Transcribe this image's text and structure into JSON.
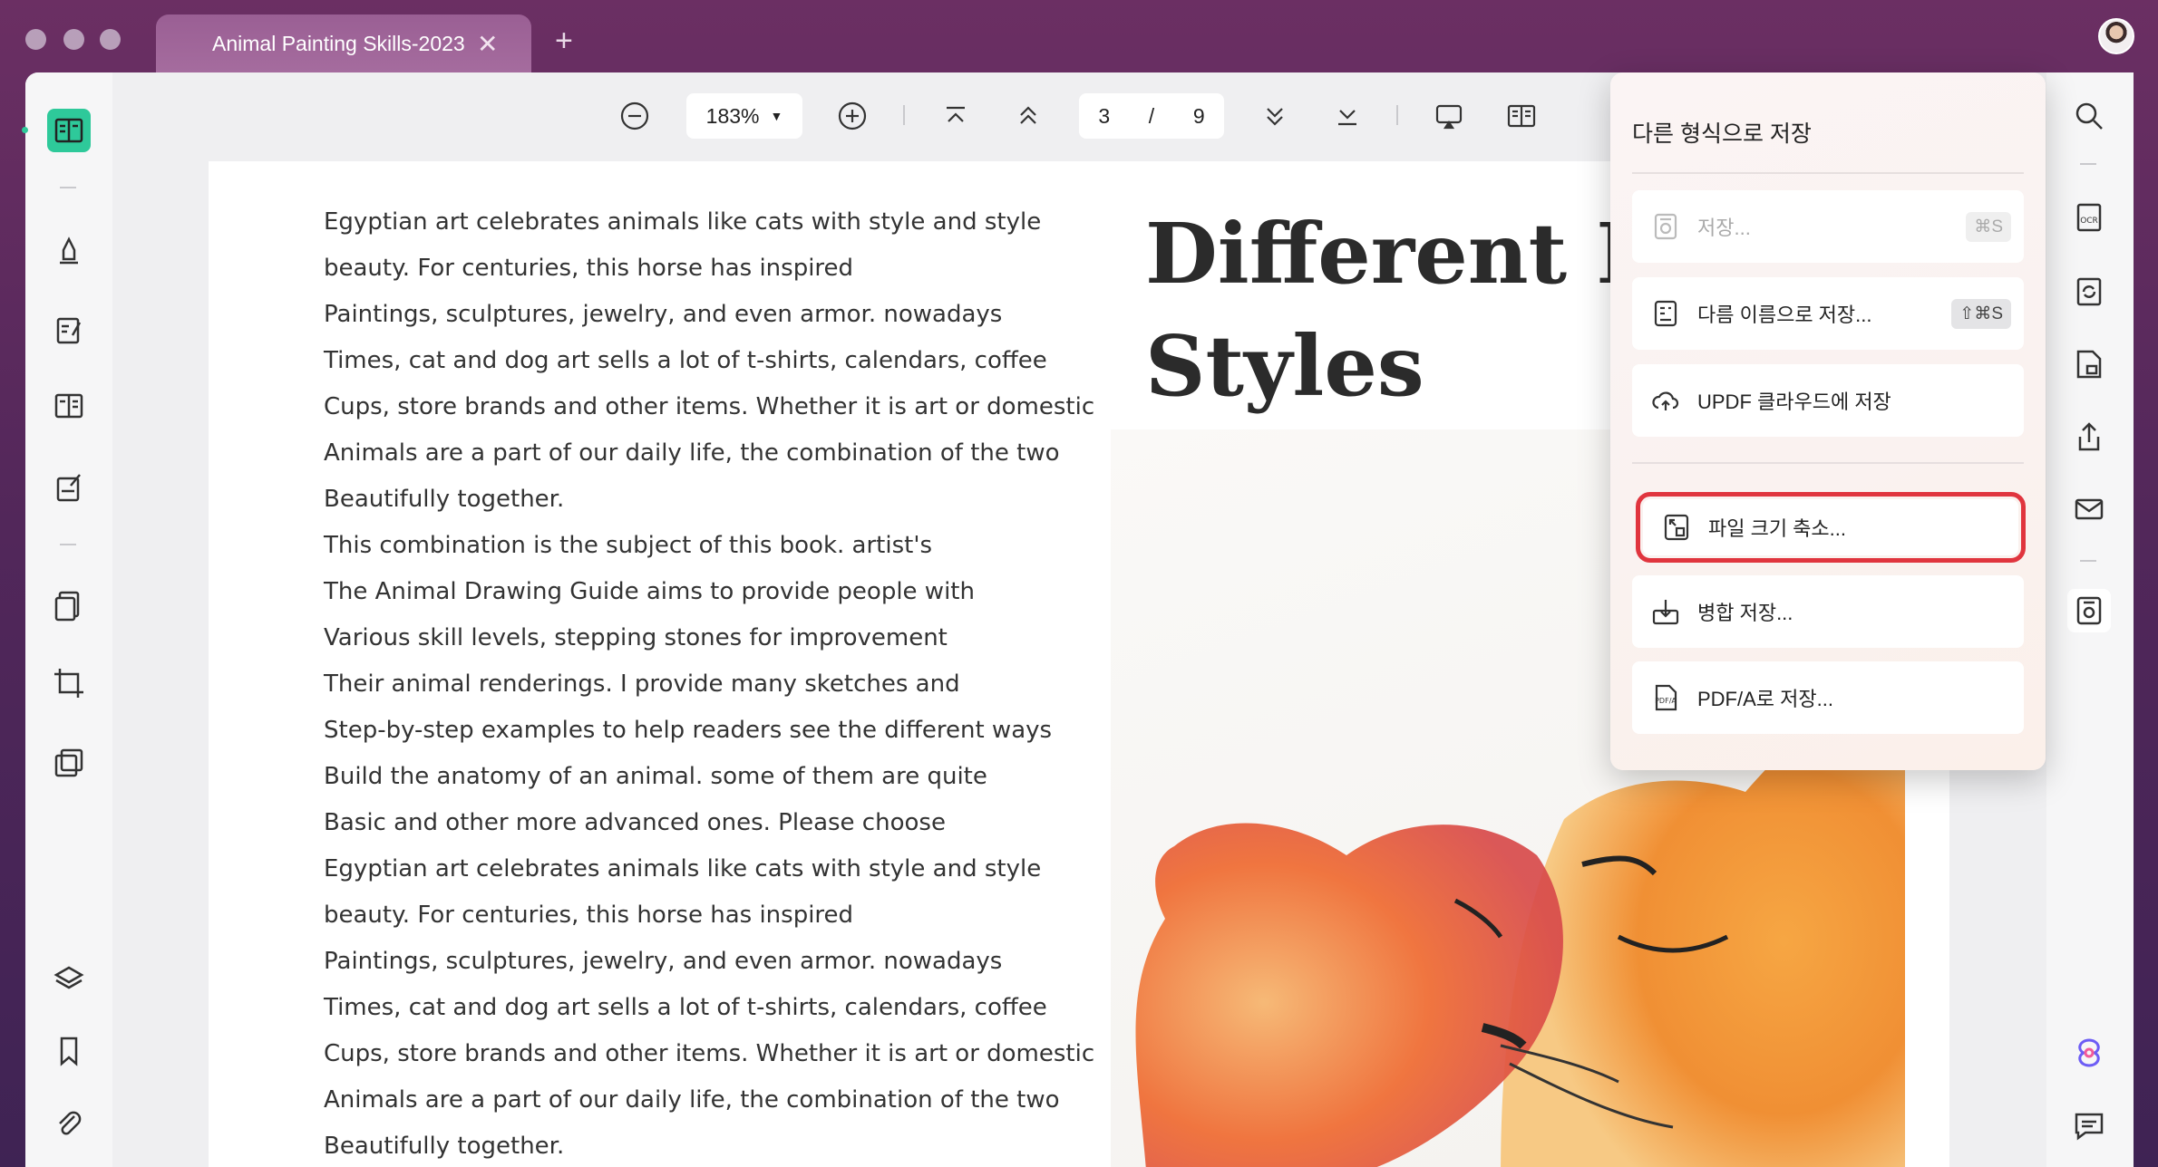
{
  "tab": {
    "title": "Animal Painting Skills-2023"
  },
  "toolbar": {
    "zoom": "183%",
    "current_page": "3",
    "page_separator": "/",
    "total_pages": "9"
  },
  "document": {
    "heading_line1": "Different Pai",
    "heading_line2": "Styles",
    "lines": [
      "Egyptian art celebrates animals like cats with style and style",
      "beauty. For centuries, this horse has inspired",
      "Paintings, sculptures, jewelry, and even armor. nowadays",
      "Times, cat and dog art sells a lot of t-shirts, calendars, coffee",
      "Cups, store brands and other items. Whether it is art or domestic",
      "Animals are a part of our daily life, the combination of the two",
      "Beautifully together.",
      "This combination is the subject of this book. artist's",
      "The Animal Drawing Guide aims to provide people with",
      "Various skill levels, stepping stones for improvement",
      "Their animal renderings. I provide many sketches and",
      "Step-by-step examples to help readers see the different ways",
      "Build the anatomy of an animal. some of them are quite",
      "Basic and other more advanced ones. Please choose",
      "Egyptian art celebrates animals like cats with style and style",
      "beauty. For centuries, this horse has inspired",
      "Paintings, sculptures, jewelry, and even armor. nowadays",
      "Times, cat and dog art sells a lot of t-shirts, calendars, coffee",
      "Cups, store brands and other items. Whether it is art or domestic",
      "Animals are a part of our daily life, the combination of the two",
      "Beautifully together."
    ]
  },
  "menu": {
    "title": "다른 형식으로 저장",
    "items": [
      {
        "label": "저장...",
        "shortcut": "⌘S",
        "disabled": true
      },
      {
        "label": "다름 이름으로 저장...",
        "shortcut": "⇧⌘S"
      },
      {
        "label": "UPDF 클라우드에 저장"
      },
      {
        "label": "파일 크기 축소..."
      },
      {
        "label": "병합 저장..."
      },
      {
        "label": "PDF/A로 저장..."
      }
    ]
  },
  "colors": {
    "accent": "#2ec99a",
    "highlight": "#e0353e"
  }
}
